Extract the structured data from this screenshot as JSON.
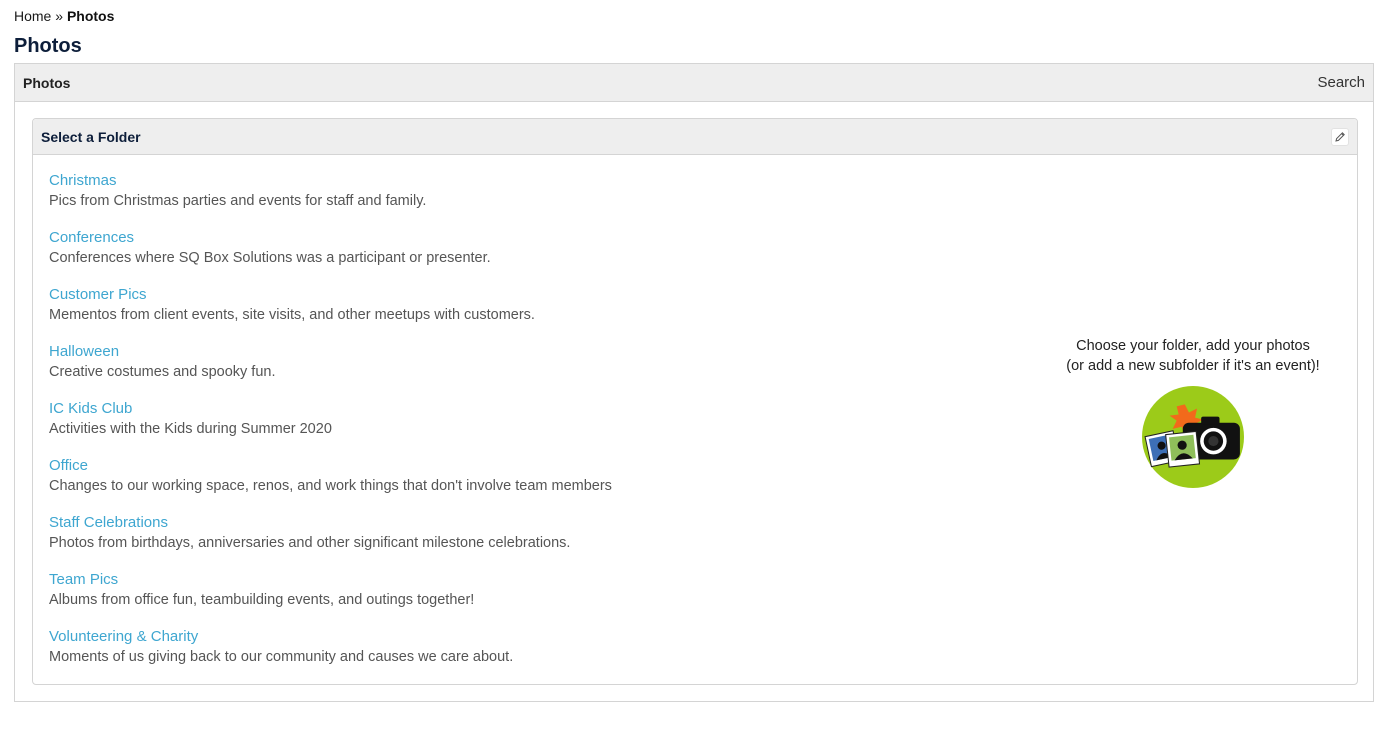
{
  "breadcrumb": {
    "home": "Home",
    "separator": "»",
    "current": "Photos"
  },
  "page_title": "Photos",
  "outer_panel": {
    "tab_label": "Photos",
    "search_label": "Search"
  },
  "folder_panel": {
    "title": "Select a Folder",
    "edit_icon": "pencil-icon"
  },
  "folders": [
    {
      "name": "Christmas",
      "description": "Pics from Christmas parties and events for staff and family."
    },
    {
      "name": "Conferences",
      "description": "Conferences where SQ Box Solutions was a participant or presenter."
    },
    {
      "name": "Customer Pics",
      "description": "Mementos from client events, site visits, and other meetups with customers."
    },
    {
      "name": "Halloween",
      "description": "Creative costumes and spooky fun."
    },
    {
      "name": "IC Kids Club",
      "description": "Activities with the Kids during Summer 2020"
    },
    {
      "name": "Office",
      "description": "Changes to our working space, renos, and work things that don't involve team members"
    },
    {
      "name": "Staff Celebrations",
      "description": "Photos from birthdays, anniversaries and other significant milestone celebrations."
    },
    {
      "name": "Team Pics",
      "description": "Albums from office fun, teambuilding events, and outings together!"
    },
    {
      "name": "Volunteering & Charity",
      "description": "Moments of us giving back to our community and causes we care about."
    }
  ],
  "promo": {
    "line1": "Choose your folder, add your photos",
    "line2": "(or add a new subfolder if it's an event)!",
    "icon": "camera-photos-icon"
  },
  "colors": {
    "link": "#3ea6d0",
    "header_bg": "#eeeeee",
    "icon_circle": "#9ccb19"
  }
}
